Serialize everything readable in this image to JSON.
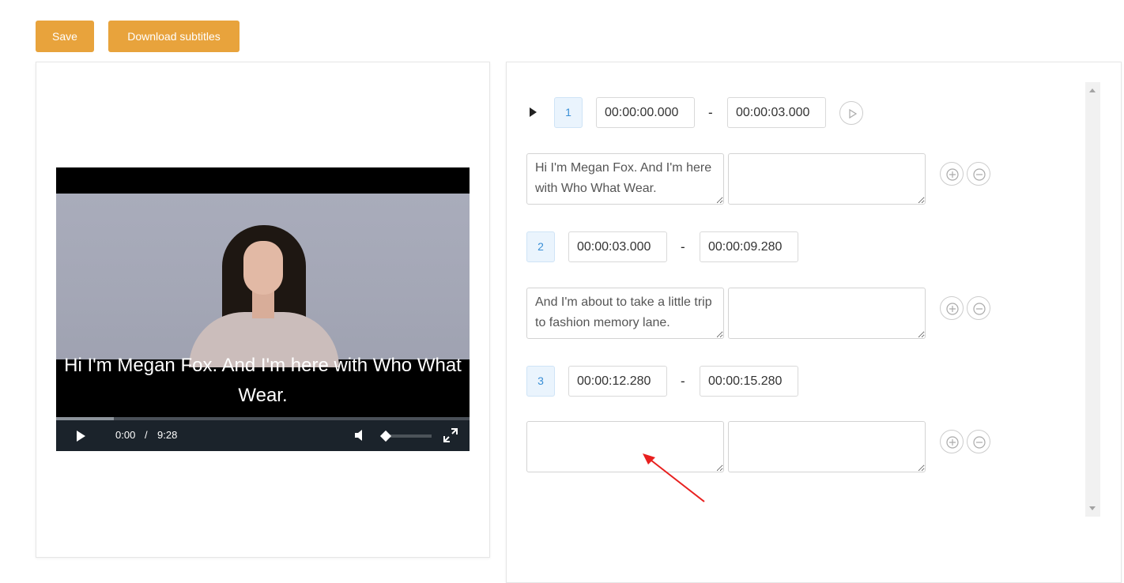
{
  "toolbar": {
    "save_label": "Save",
    "download_label": "Download subtitles",
    "accent_color": "#e8a33c"
  },
  "player": {
    "caption": "Hi I'm Megan Fox. And I'm here with Who What Wear.",
    "current_time": "0:00",
    "separator": "/",
    "duration": "9:28",
    "progress_fraction": 0.0,
    "buffered_fraction": 0.14,
    "volume_fraction": 0.0,
    "icons": {
      "play": "play-icon",
      "volume": "volume-icon",
      "fullscreen": "fullscreen-icon"
    }
  },
  "subtitles": [
    {
      "index": "1",
      "start": "00:00:00.000",
      "end": "00:00:03.000",
      "text": "Hi I'm Megan Fox. And I'm here with Who What Wear.",
      "translation": ""
    },
    {
      "index": "2",
      "start": "00:00:03.000",
      "end": "00:00:09.280",
      "text": "And I'm about to take a little trip to fashion memory lane.",
      "translation": ""
    },
    {
      "index": "3",
      "start": "00:00:12.280",
      "end": "00:00:15.280",
      "text": "",
      "translation": ""
    }
  ],
  "editor": {
    "range_separator": "-",
    "icons": {
      "expand": "caret-right-icon",
      "preview": "play-circle-icon",
      "add": "plus-circle-icon",
      "remove": "minus-circle-icon"
    },
    "annotation_color": "#e8201f"
  }
}
